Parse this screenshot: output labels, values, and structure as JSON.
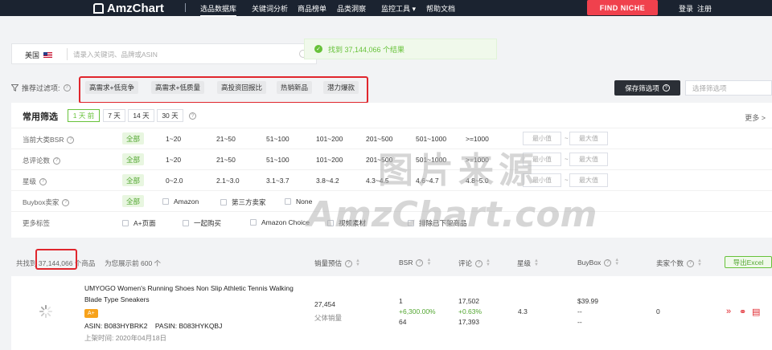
{
  "nav": {
    "logo": "AmzChart",
    "items": [
      "选品数据库",
      "关键词分析",
      "商品榜单",
      "品类洞察",
      "监控工具 ▾",
      "帮助文档"
    ],
    "find_niche": "FIND NICHE",
    "login": "登录",
    "register": "注册"
  },
  "search": {
    "country": "美国",
    "placeholder": "请录入关键词、品牌或ASIN"
  },
  "toast": {
    "text": "找到 37,144,066 个结果"
  },
  "recommended": {
    "label": "推荐过滤项:",
    "tags": [
      "高需求+低竞争",
      "高需求+低质量",
      "高投资回报比",
      "热销新品",
      "潜力爆款"
    ],
    "save_button": "保存筛选项",
    "select_placeholder": "选择筛选项"
  },
  "filters": {
    "title": "常用筛选",
    "days": [
      "1 天 前",
      "7 天",
      "14 天",
      "30 天"
    ],
    "more": "更多 >",
    "all": "全部",
    "min": "最小值",
    "max": "最大值",
    "tilde": "~",
    "bsr_label": "当前大类BSR",
    "bsr_opts": [
      "1~20",
      "21~50",
      "51~100",
      "101~200",
      "201~500",
      "501~1000",
      ">=1000"
    ],
    "review_label": "总评论数",
    "review_opts": [
      "1~20",
      "21~50",
      "51~100",
      "101~200",
      "201~500",
      "501~1000",
      ">=1000"
    ],
    "star_label": "星级",
    "star_opts": [
      "0~2.0",
      "2.1~3.0",
      "3.1~3.7",
      "3.8~4.2",
      "4.3~4.5",
      "4.6~4.7",
      "4.8~5.0"
    ],
    "buybox_label": "Buybox卖家",
    "buybox_opts": [
      "Amazon",
      "第三方卖家",
      "None"
    ],
    "tags_label": "更多标签",
    "tag_opts": [
      "A+页面",
      "一起购买",
      "Amazon Choice",
      "视频素材",
      "排除已下架商品"
    ]
  },
  "results": {
    "found_prefix": "共找到",
    "found_count": "37,144,066",
    "found_suffix": "个商品",
    "showing": "为您展示前 600 个",
    "columns": [
      "销量预估",
      "BSR",
      "评论",
      "星级",
      "BuyBox",
      "卖家个数"
    ],
    "export": "导出Excel"
  },
  "product": {
    "title": "UMYOGO Women's Running Shoes Non Slip Athletic Tennis Walking Blade Type Sneakers",
    "badge": "A+",
    "asin": "ASIN: B083HYBRK2",
    "pasin": "PASIN: B083HYKQBJ",
    "listed": "上架时间: 2020年04月18日",
    "sales": "27,454",
    "sales_note": "父体销量",
    "bsr": "1",
    "bsr_change": "+6,300.00%",
    "bsr_prev": "64",
    "reviews": "17,502",
    "reviews_change": "+0.63%",
    "reviews_prev": "17,393",
    "rating": "4.3",
    "price": "$39.99",
    "buybox_line2": "--",
    "buybox_line3": "--",
    "sellers": "0"
  },
  "watermark": {
    "line1": "图片来源",
    "line2": "AmzChart.com"
  },
  "colors": {
    "accent_green": "#67c23a",
    "brand_red": "#f0414d",
    "nav_bg": "#1b2330"
  }
}
